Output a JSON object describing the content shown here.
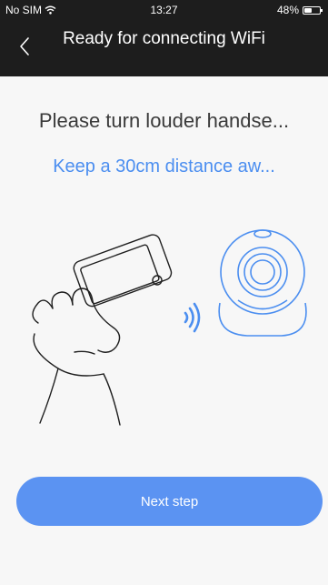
{
  "status_bar": {
    "carrier": "No SIM",
    "time": "13:27",
    "battery_percent": "48%",
    "battery_level": 0.48
  },
  "navbar": {
    "title": "Ready for connecting WiFi"
  },
  "content": {
    "headline": "Please turn louder handse...",
    "subline": "Keep a 30cm distance aw..."
  },
  "actions": {
    "next_label": "Next step"
  },
  "colors": {
    "accent": "#5b93f2",
    "accent_text": "#4b8ef0",
    "header_bg": "#1d1d1d",
    "page_bg": "#f7f7f7"
  },
  "icons": {
    "back": "chevron-left-icon",
    "wifi": "wifi-icon",
    "sound": "sound-waves-icon"
  }
}
